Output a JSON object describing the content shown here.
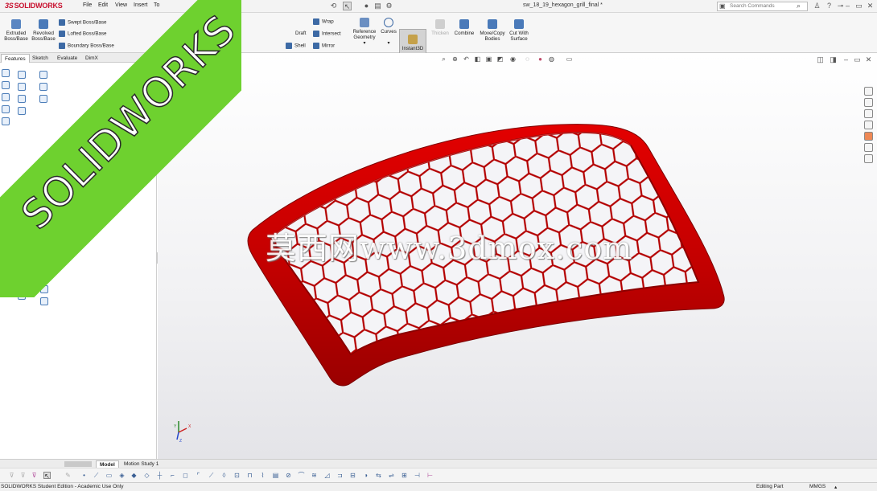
{
  "app": {
    "logo_ds": "3S",
    "logo_name": "SOLIDWORKS"
  },
  "menu": [
    "File",
    "Edit",
    "View",
    "Insert",
    "To"
  ],
  "document_title": "sw_18_19_hexagon_grill_final *",
  "search": {
    "placeholder": "Search Commands"
  },
  "command_manager": {
    "extruded": "Extruded Boss/Base",
    "revolved": "Revolved Boss/Base",
    "swept": "Swept Boss/Base",
    "lofted": "Lofted Boss/Base",
    "boundary": "Boundary Boss/Base",
    "wrap": "Wrap",
    "draft": "Draft",
    "intersect": "Intersect",
    "shell": "Shell",
    "mirror": "Mirror",
    "reference_geometry": "Reference Geometry",
    "curves": "Curves",
    "instant3d": "Instant3D",
    "thicken": "Thicken",
    "combine": "Combine",
    "move_copy": "Move/Copy Bodies",
    "cut_with_surface": "Cut With Surface"
  },
  "tabs": [
    "Features",
    "Sketch",
    "Evaluate",
    "DimX"
  ],
  "bottom_tabs": {
    "model": "Model",
    "motion": "Motion Study 1"
  },
  "status": {
    "left": "SOLIDWORKS Student Edition - Academic Use Only",
    "mode": "Editing Part",
    "units": "MMGS"
  },
  "watermark": "莫西网www.3dmox.com",
  "banner": "SOLIDWORKS",
  "colors": {
    "part": "#cc0000",
    "banner": "#6ed12f",
    "instant3d_bg": "#d3d3d3"
  },
  "triad": {
    "x": "X",
    "y": "Y",
    "z": "Z"
  }
}
